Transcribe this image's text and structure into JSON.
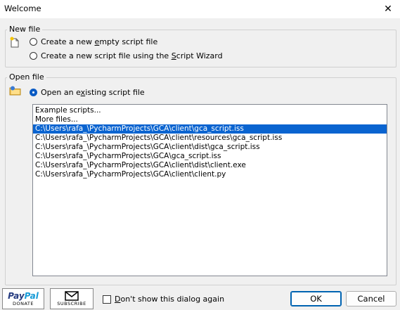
{
  "window": {
    "title": "Welcome"
  },
  "new_file": {
    "group_label": "New file",
    "option_empty": {
      "before": "Create a new ",
      "underlined": "e",
      "after": "mpty script file"
    },
    "option_wizard": {
      "before": "Create a new script file using the ",
      "underlined": "S",
      "after": "cript Wizard"
    }
  },
  "open_file": {
    "group_label": "Open file",
    "option_existing": {
      "before": "Open an e",
      "underlined": "x",
      "after": "isting script file"
    },
    "files": [
      "Example scripts...",
      "More files...",
      "C:\\Users\\rafa_\\PycharmProjects\\GCA\\client\\gca_script.iss",
      "C:\\Users\\rafa_\\PycharmProjects\\GCA\\client\\resources\\gca_script.iss",
      "C:\\Users\\rafa_\\PycharmProjects\\GCA\\client\\dist\\gca_script.iss",
      "C:\\Users\\rafa_\\PycharmProjects\\GCA\\gca_script.iss",
      "C:\\Users\\rafa_\\PycharmProjects\\GCA\\client\\dist\\client.exe",
      "C:\\Users\\rafa_\\PycharmProjects\\GCA\\client\\client.py"
    ],
    "selected_index": 2
  },
  "footer": {
    "paypal_logo_a": "Pay",
    "paypal_logo_b": "Pal",
    "paypal_sub": "DONATE",
    "subscribe_sub": "SUBSCRIBE",
    "dont_show": {
      "underlined": "D",
      "after": "on't show this dialog again"
    },
    "ok_label": "OK",
    "cancel_label": "Cancel"
  },
  "icons": [
    "close-icon",
    "new-file-icon",
    "open-folder-icon",
    "envelope-icon"
  ],
  "colors": {
    "selection": "#0a64d0",
    "radio_checked": "#0a5bc4",
    "paypal_dark": "#253b80",
    "paypal_light": "#179bd7"
  }
}
